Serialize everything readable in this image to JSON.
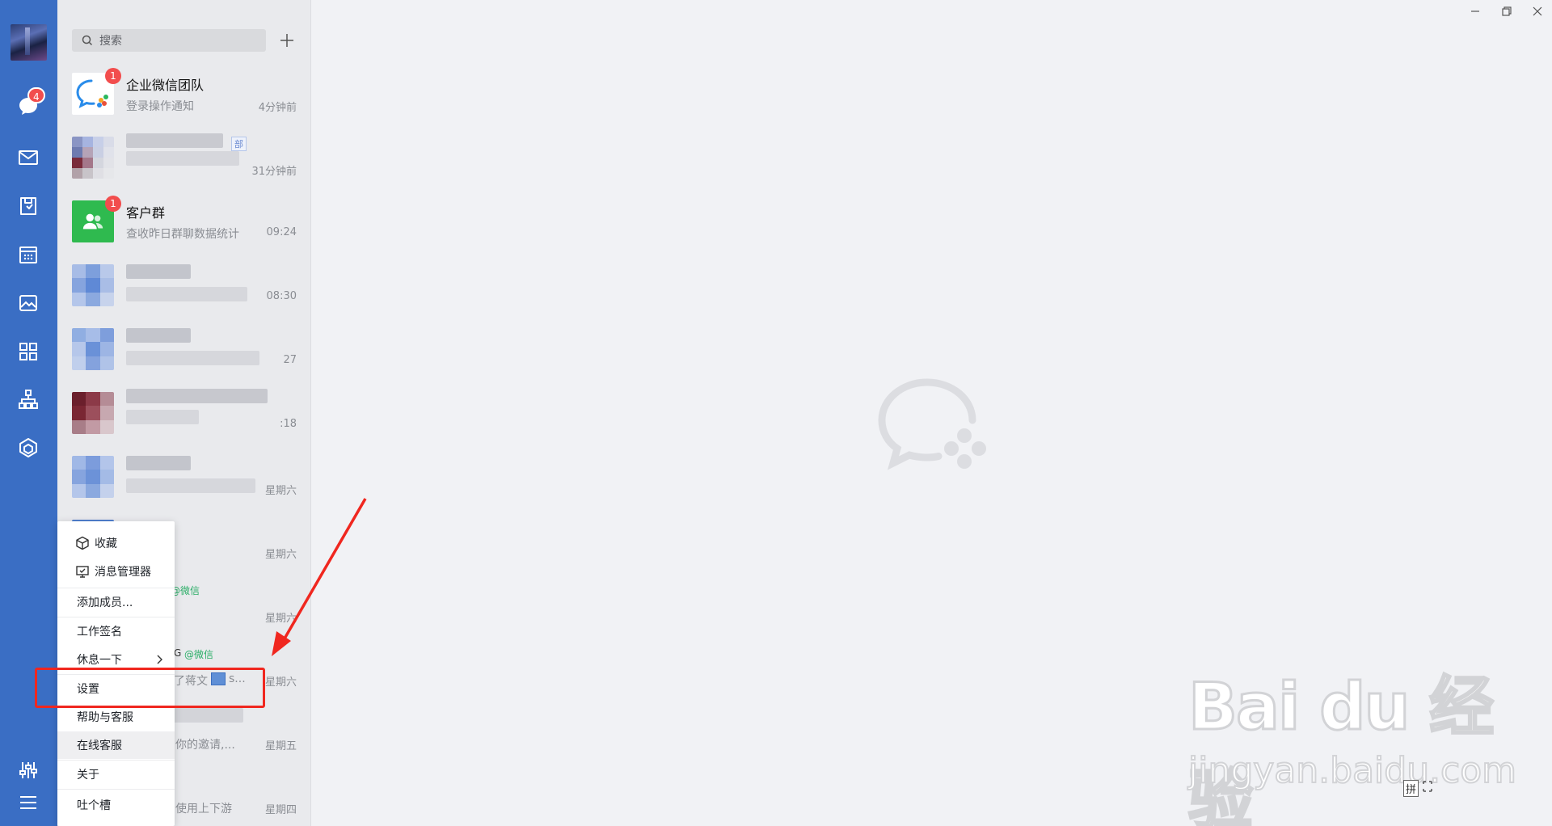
{
  "rail": {
    "chat_badge": "4",
    "icons": [
      "chat-icon",
      "mail-icon",
      "docs-icon",
      "calendar-icon",
      "photos-icon",
      "apps-icon",
      "org-chart-icon",
      "workbench-icon",
      "settings-sliders-icon",
      "menu-icon"
    ]
  },
  "search": {
    "placeholder": "搜索"
  },
  "conversations": [
    {
      "name": "企业微信团队",
      "preview": "登录操作通知",
      "time": "4分钟前",
      "badge": "1",
      "avatar": "wecom-team-logo"
    },
    {
      "name": "",
      "preview": "",
      "time": "31分钟前",
      "tag": "部",
      "avatar": "pixelated"
    },
    {
      "name": "客户群",
      "preview": "查收昨日群聊数据统计",
      "time": "09:24",
      "badge": "1",
      "avatar": "group-icon"
    },
    {
      "name": "",
      "preview": "",
      "time": "08:30",
      "avatar": "pixelated"
    },
    {
      "name": "",
      "preview": "",
      "time": "27",
      "avatar": "pixelated"
    },
    {
      "name": "",
      "preview": "",
      "time": ":18",
      "avatar": "pixelated"
    },
    {
      "name": "",
      "preview": "",
      "time": "星期六",
      "avatar": "pixelated"
    },
    {
      "name": "",
      "preview": "",
      "time": "星期六",
      "avatar": "pixelated"
    },
    {
      "name": "",
      "preview": "",
      "time": "星期六",
      "source": "@微信",
      "avatar": "pixelated"
    },
    {
      "name": "G",
      "preview": "了蒋文",
      "preview_suffix": "s...",
      "time": "星期六",
      "source": "@微信",
      "avatar": "pixelated"
    },
    {
      "name": "",
      "preview": "你的邀请,...",
      "time": "星期五",
      "avatar": "pixelated"
    },
    {
      "name": "",
      "preview": "使用上下游",
      "time": "星期四",
      "avatar": "pixelated"
    }
  ],
  "menu": {
    "items": [
      {
        "label": "收藏",
        "icon": "cube-icon"
      },
      {
        "label": "消息管理器",
        "icon": "message-manager-icon"
      },
      {
        "label": "添加成员..."
      },
      {
        "label": "工作签名"
      },
      {
        "label": "休息一下",
        "has_submenu": true
      },
      {
        "label": "设置",
        "highlighted_by_annotation": true
      },
      {
        "label": "帮助与客服"
      },
      {
        "label": "在线客服",
        "hover": true
      },
      {
        "label": "关于"
      },
      {
        "label": "吐个槽"
      }
    ]
  },
  "ime": {
    "mode": "拼"
  },
  "watermark": {
    "brand": "Bai du 经验",
    "url": "jingyan.baidu.com"
  },
  "colors": {
    "rail": "#3a6ec4",
    "badge": "#f24d4d",
    "annotation": "#f0271f",
    "wechat_source": "#2aae67"
  }
}
